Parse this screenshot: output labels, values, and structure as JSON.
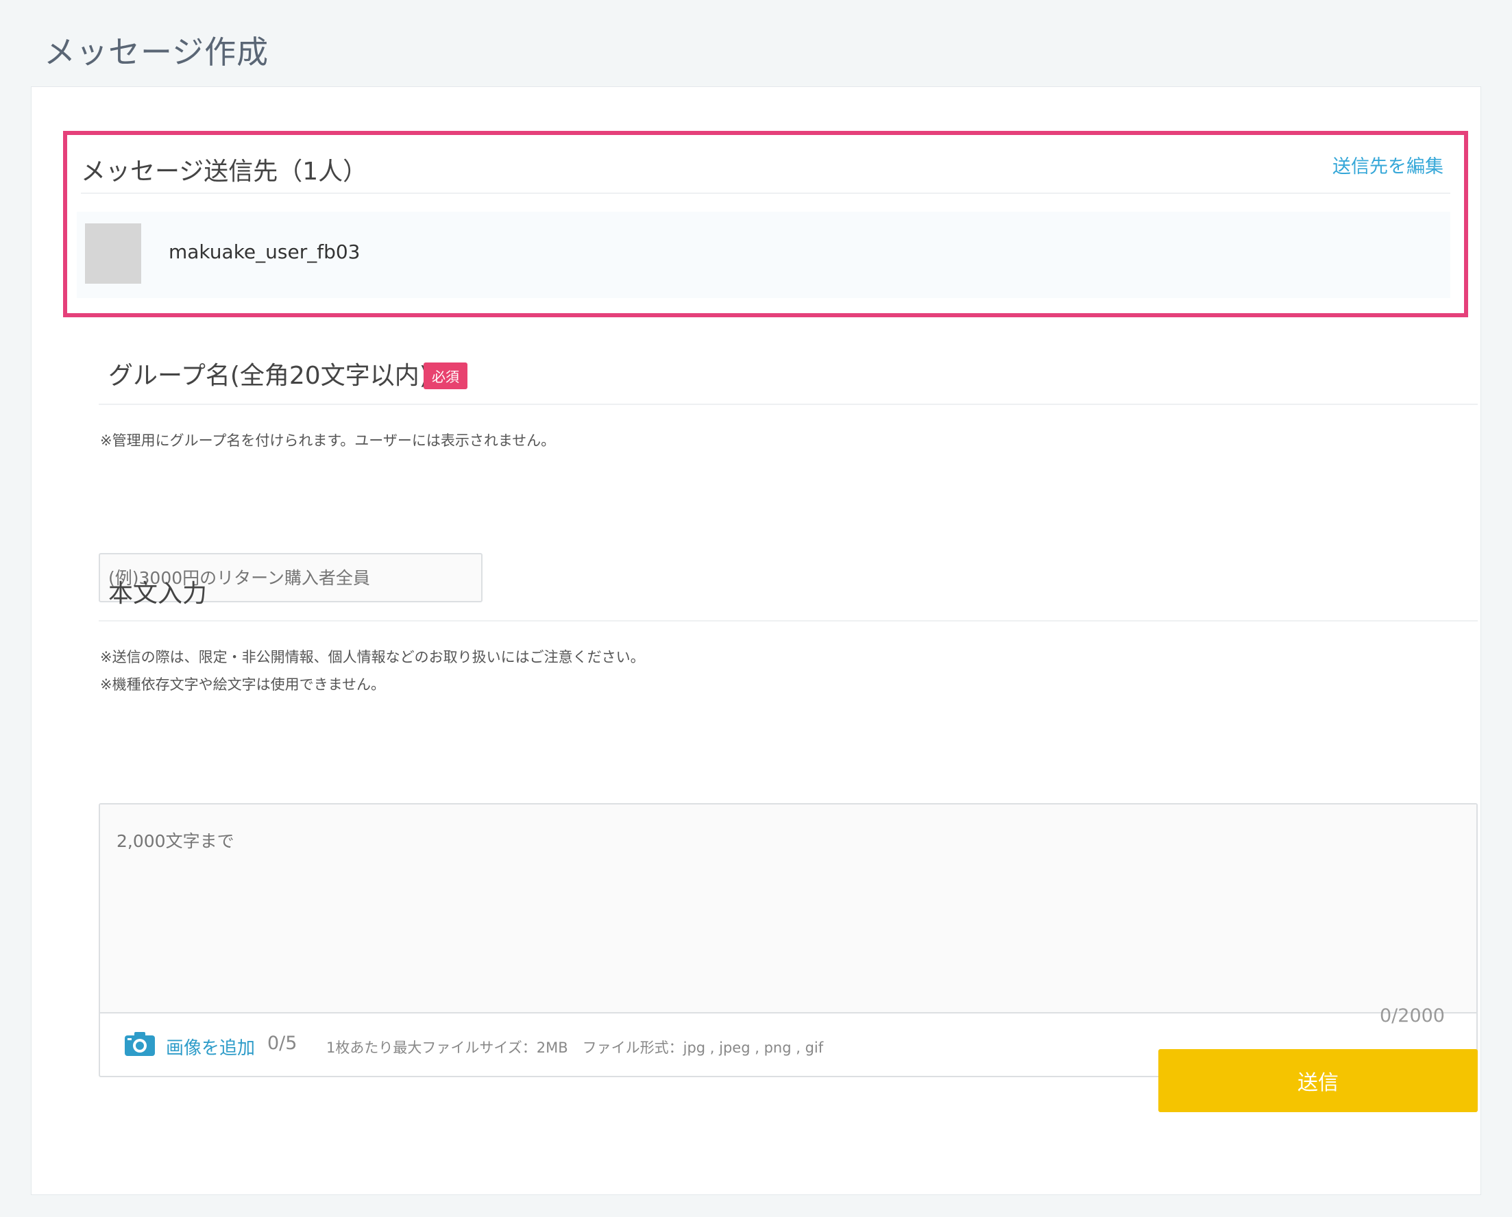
{
  "page": {
    "title": "メッセージ作成"
  },
  "recipients": {
    "title": "メッセージ送信先（1人）",
    "edit_label": "送信先を編集",
    "users": [
      {
        "name": "makuake_user_fb03"
      }
    ]
  },
  "group": {
    "title": "グループ名(全角20文字以内)",
    "badge": "必須",
    "note": "※管理用にグループ名を付けられます。ユーザーには表示されません。",
    "placeholder": "(例)3000円のリターン購入者全員"
  },
  "body": {
    "title": "本文入力",
    "note1": "※送信の際は、限定・非公開情報、個人情報などのお取り扱いにはご注意ください。",
    "note2": "※機種依存文字や絵文字は使用できません。",
    "placeholder": "2,000文字まで",
    "add_image_label": "画像を追加",
    "image_count": "0/5",
    "file_info": "1枚あたり最大ファイルサイズ：2MB　ファイル形式：jpg , jpeg , png , gif",
    "char_count": "0/2000"
  },
  "send_label": "送信",
  "colors": {
    "highlight": "#e5407a",
    "link": "#35a7d8",
    "badge": "#e8426f",
    "send": "#f5c400"
  }
}
